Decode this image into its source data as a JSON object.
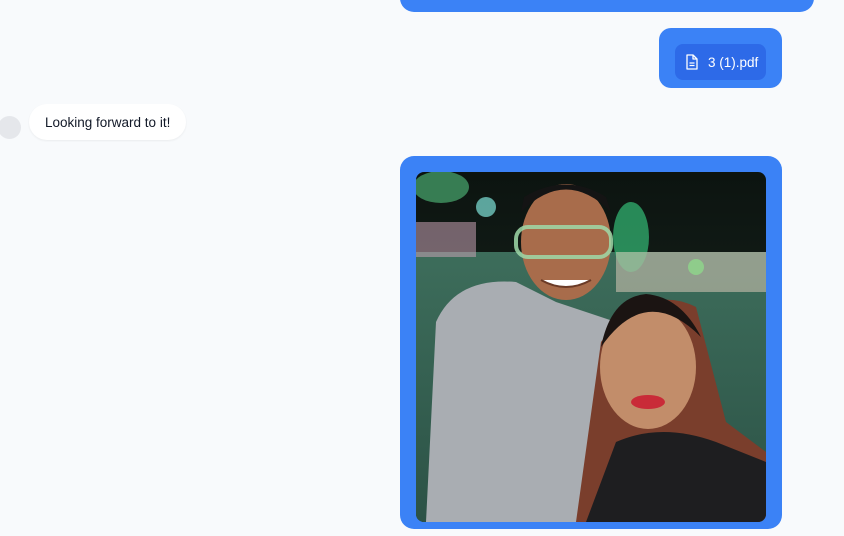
{
  "messages": [
    {
      "type": "outgoing-partial",
      "text": ""
    },
    {
      "type": "outgoing-file",
      "file_name": "3 (1).pdf",
      "icon": "document-icon"
    },
    {
      "type": "incoming-text",
      "text": "Looking forward to it!"
    },
    {
      "type": "outgoing-image",
      "image": "selfie-photo"
    }
  ],
  "colors": {
    "outgoing_bubble": "#3b82f6",
    "incoming_bubble": "#ffffff",
    "background": "#f8fafc"
  }
}
